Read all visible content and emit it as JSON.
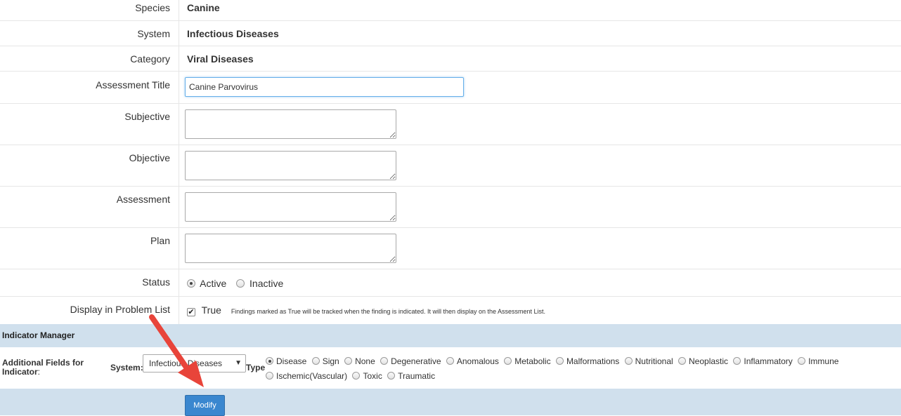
{
  "form": {
    "species": {
      "label": "Species",
      "value": "Canine"
    },
    "system": {
      "label": "System",
      "value": "Infectious Diseases"
    },
    "category": {
      "label": "Category",
      "value": "Viral Diseases"
    },
    "assessment_title": {
      "label": "Assessment Title",
      "value": "Canine Parvovirus"
    },
    "subjective": {
      "label": "Subjective",
      "value": ""
    },
    "objective": {
      "label": "Objective",
      "value": ""
    },
    "assessment": {
      "label": "Assessment",
      "value": ""
    },
    "plan": {
      "label": "Plan",
      "value": ""
    },
    "status": {
      "label": "Status",
      "options": [
        "Active",
        "Inactive"
      ],
      "selected": "Active"
    },
    "display_in_problem_list": {
      "label": "Display in Problem List",
      "checked": true,
      "checkbox_label": "True",
      "note": "Findings marked as True will be tracked when the finding is indicated. It will then display on the Assessment List."
    }
  },
  "indicator_manager": {
    "title": "Indicator Manager",
    "additional_fields_label": "Additional Fields for Indicator",
    "colon": ":",
    "system_label": "System:",
    "system_selected": "Infectious Diseases",
    "type_label": "Type",
    "type_options": [
      "Disease",
      "Sign",
      "None",
      "Degenerative",
      "Anomalous",
      "Metabolic",
      "Malformations",
      "Nutritional",
      "Neoplastic",
      "Inflammatory",
      "Immune",
      "Ischemic(Vascular)",
      "Toxic",
      "Traumatic"
    ],
    "type_selected": "Disease"
  },
  "footer": {
    "modify_label": "Modify"
  },
  "colors": {
    "section_bg": "#d0e0ed",
    "button_bg": "#3a87cf",
    "annotation_arrow": "#e8443a"
  }
}
